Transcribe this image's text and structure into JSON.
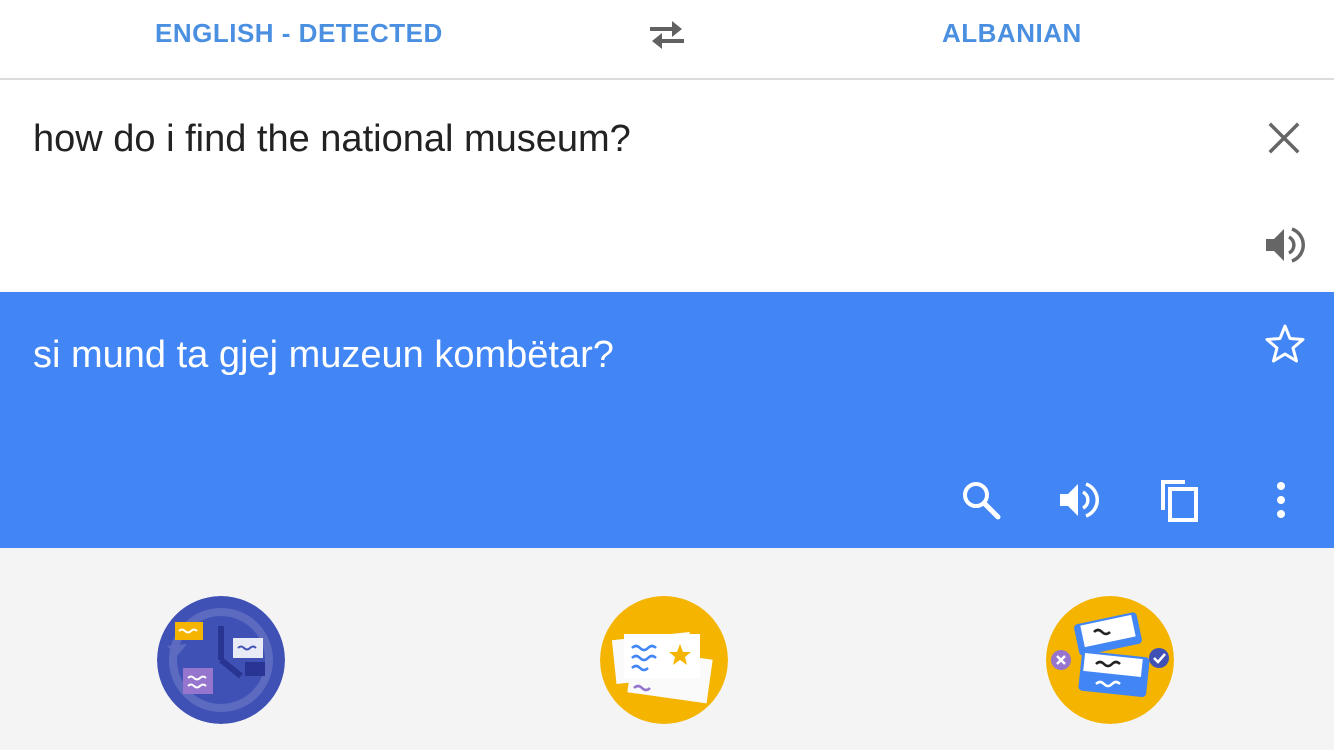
{
  "language_bar": {
    "source_language": "ENGLISH - DETECTED",
    "target_language": "ALBANIAN",
    "swap_icon": "swap-horizontal-icon"
  },
  "input": {
    "text": "how do i find the national museum?",
    "clear_icon": "close-icon",
    "speak_icon": "volume-icon"
  },
  "result": {
    "text": "si mund ta gjej muzeun kombëtar?",
    "star_icon": "star-outline-icon",
    "actions": [
      "search-icon",
      "volume-icon",
      "copy-icon",
      "more-vert-icon"
    ]
  },
  "promos": [
    {
      "icon": "phrasebook-sync-illustration"
    },
    {
      "icon": "saved-cards-illustration"
    },
    {
      "icon": "flashcards-illustration"
    }
  ],
  "colors": {
    "accent": "#4285f4",
    "language_label": "#4a8fe0",
    "promo_blue": "#3f51b5",
    "promo_yellow": "#f4b400"
  }
}
